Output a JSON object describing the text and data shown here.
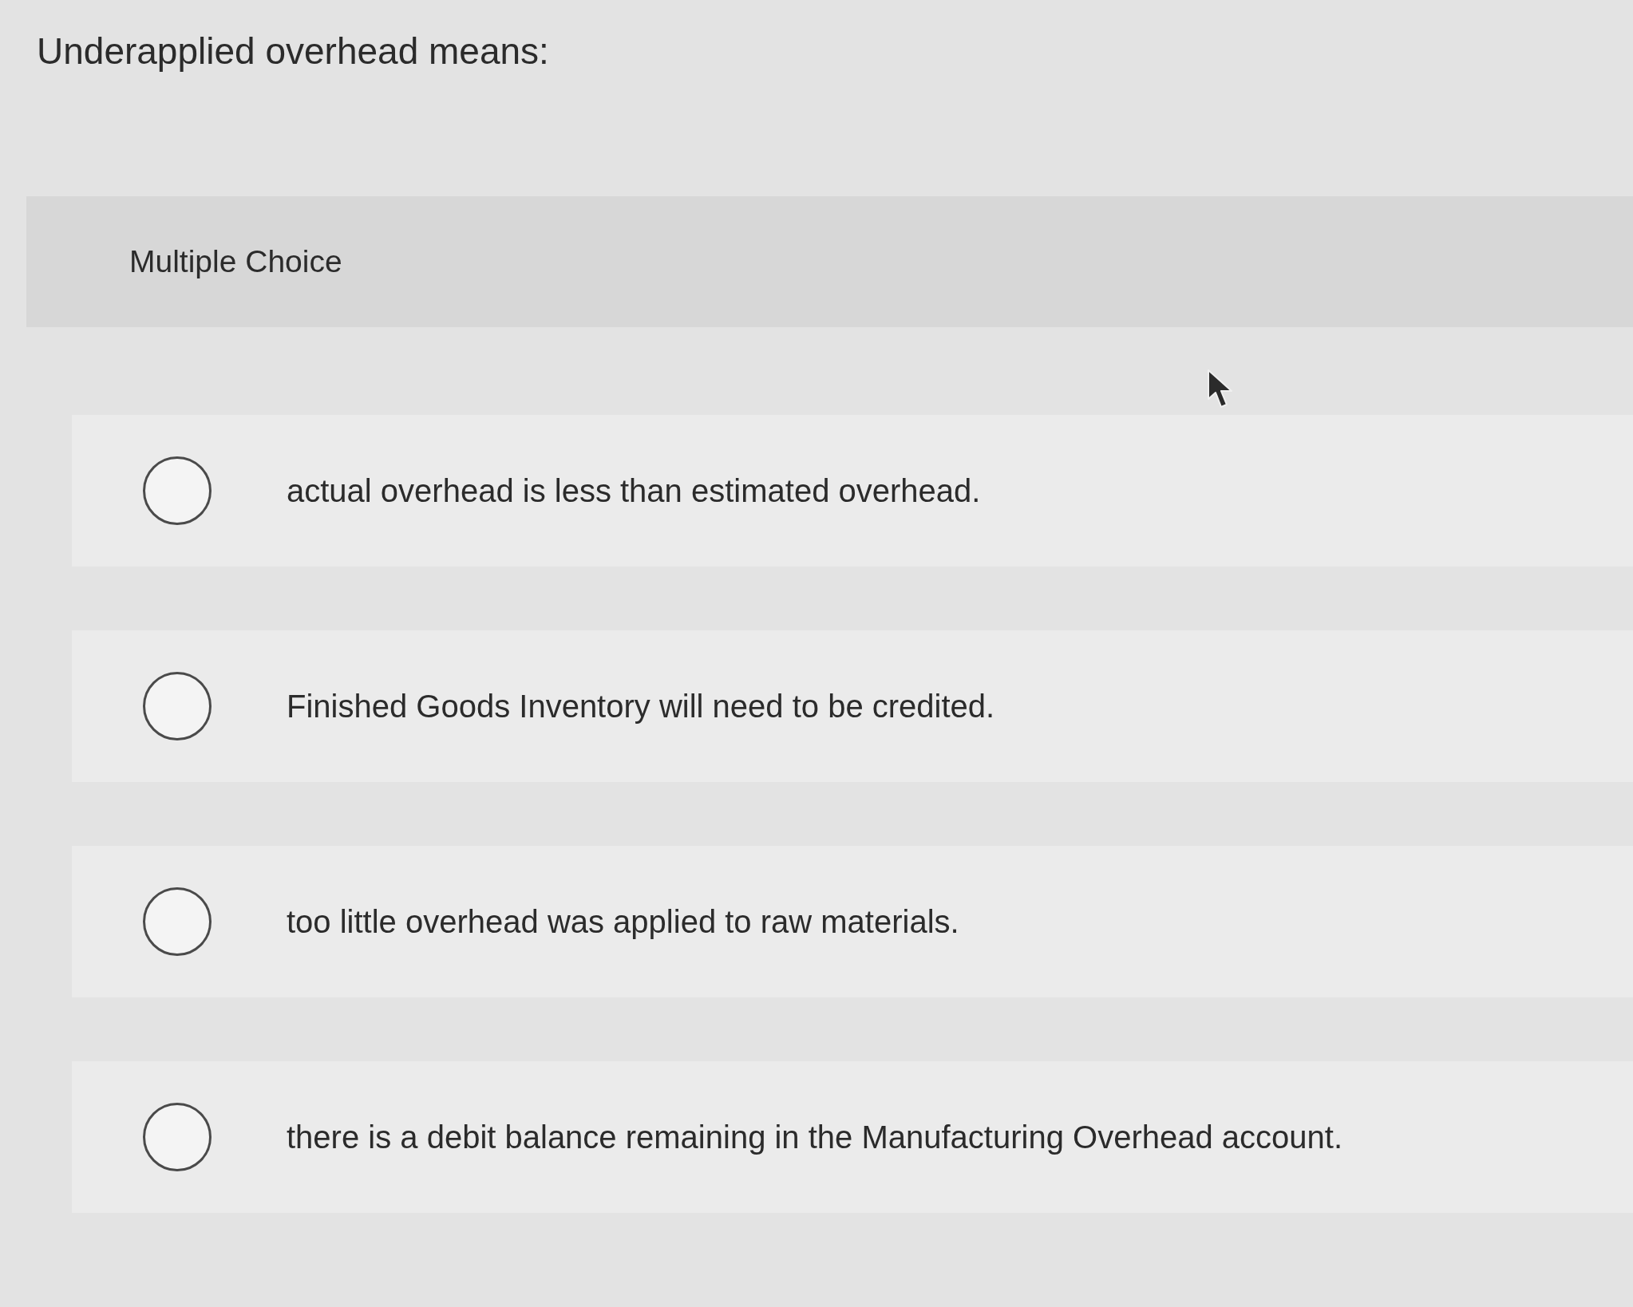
{
  "question": {
    "text": "Underapplied overhead means:"
  },
  "panel": {
    "label": "Multiple Choice"
  },
  "options": [
    {
      "text": "actual overhead is less than estimated overhead.",
      "selected": false
    },
    {
      "text": "Finished Goods Inventory will need to be credited.",
      "selected": false
    },
    {
      "text": "too little overhead was applied to raw materials.",
      "selected": false
    },
    {
      "text": "there is a debit balance remaining in the Manufacturing Overhead account.",
      "selected": false
    }
  ]
}
